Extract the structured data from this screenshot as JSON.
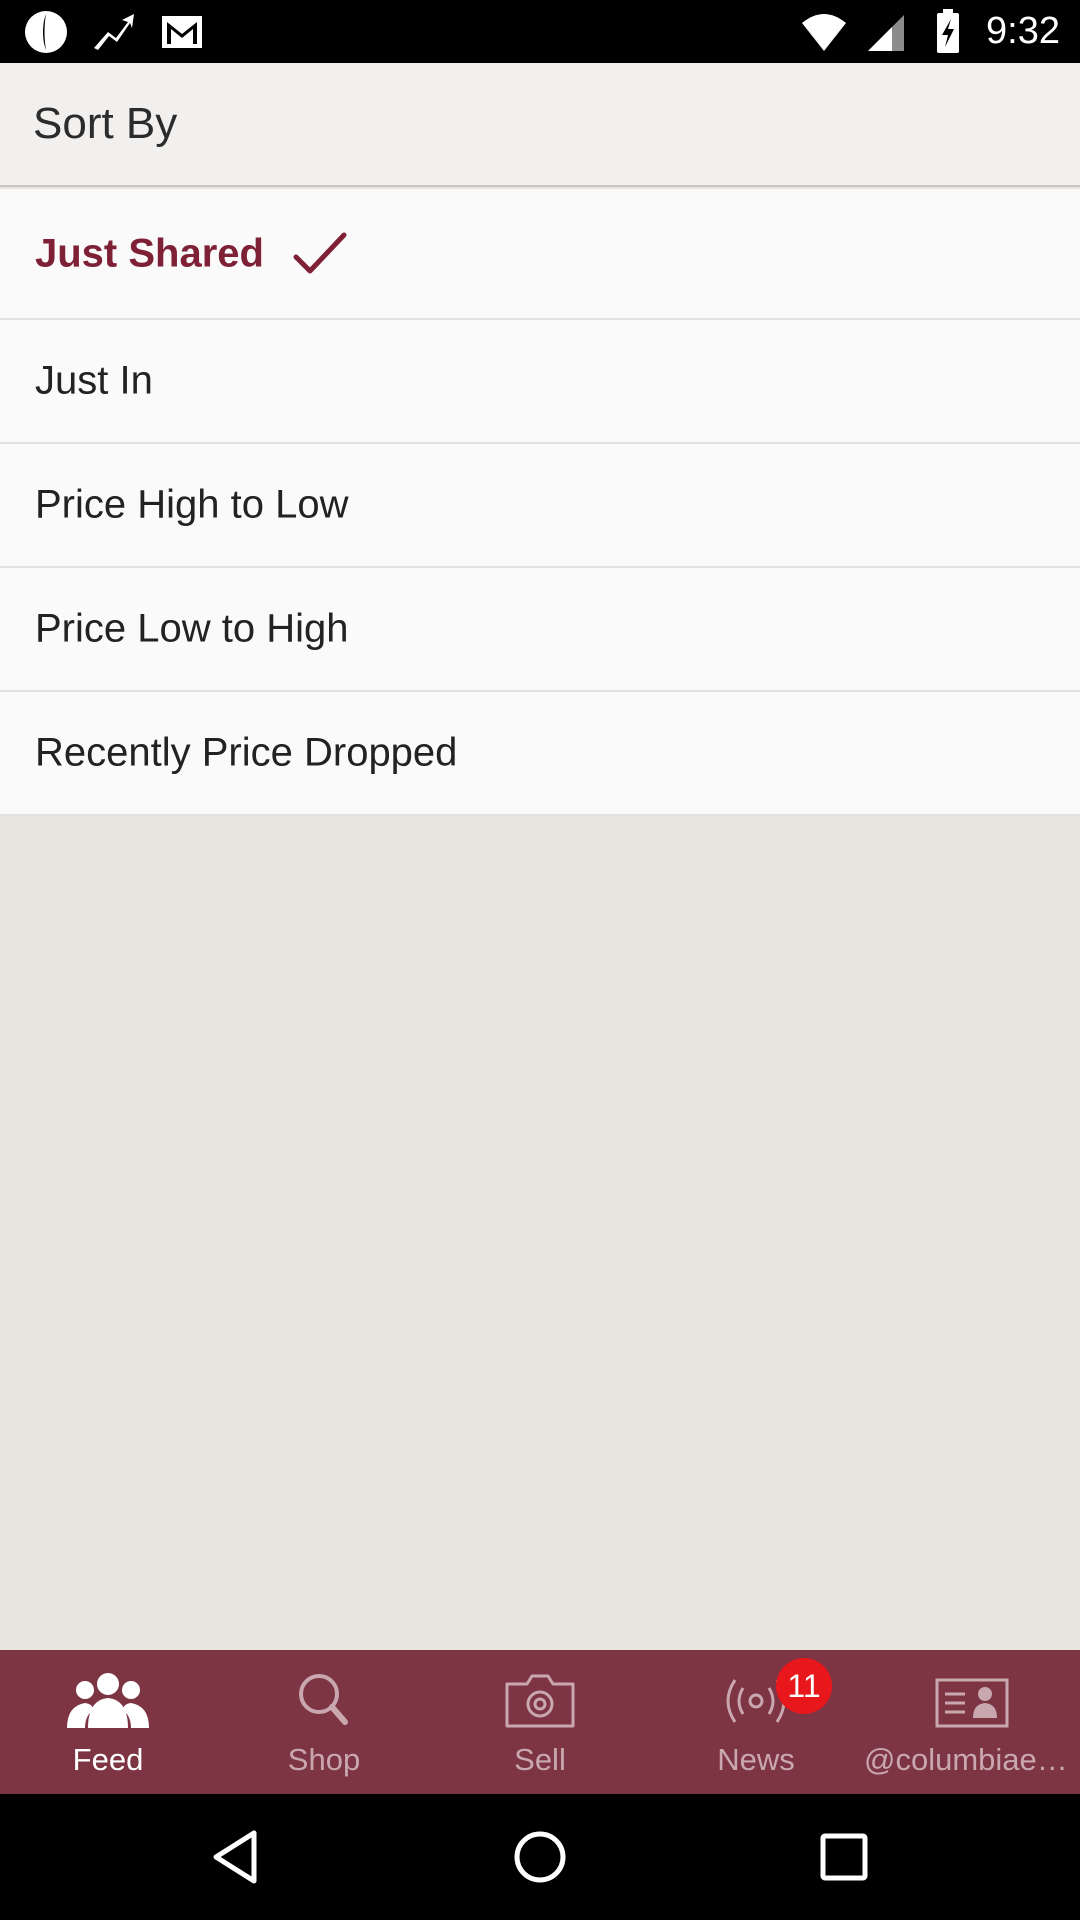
{
  "status_bar": {
    "time": "9:32",
    "icons_left": [
      "app-notification-icon",
      "trending-icon",
      "gmail-icon"
    ],
    "icons_right": [
      "wifi-icon",
      "cell-signal-icon",
      "battery-charging-icon"
    ]
  },
  "header": {
    "title": "Sort By"
  },
  "sort_options": [
    {
      "label": "Just Shared",
      "selected": true
    },
    {
      "label": "Just In",
      "selected": false
    },
    {
      "label": "Price High to Low",
      "selected": false
    },
    {
      "label": "Price Low to High",
      "selected": false
    },
    {
      "label": "Recently Price Dropped",
      "selected": false
    }
  ],
  "tab_bar": {
    "tabs": [
      {
        "label": "Feed",
        "icon": "people-icon",
        "active": true
      },
      {
        "label": "Shop",
        "icon": "search-icon",
        "active": false
      },
      {
        "label": "Sell",
        "icon": "camera-icon",
        "active": false
      },
      {
        "label": "News",
        "icon": "broadcast-icon",
        "active": false,
        "badge": "11"
      },
      {
        "label": "@columbiaex…",
        "icon": "profile-card-icon",
        "active": false
      }
    ]
  },
  "nav_bar": {
    "buttons": [
      "back-icon",
      "home-icon",
      "recents-icon"
    ]
  },
  "colors": {
    "accent": "#7f2136",
    "tab_bar": "#7d3443",
    "badge": "#e8171b"
  }
}
